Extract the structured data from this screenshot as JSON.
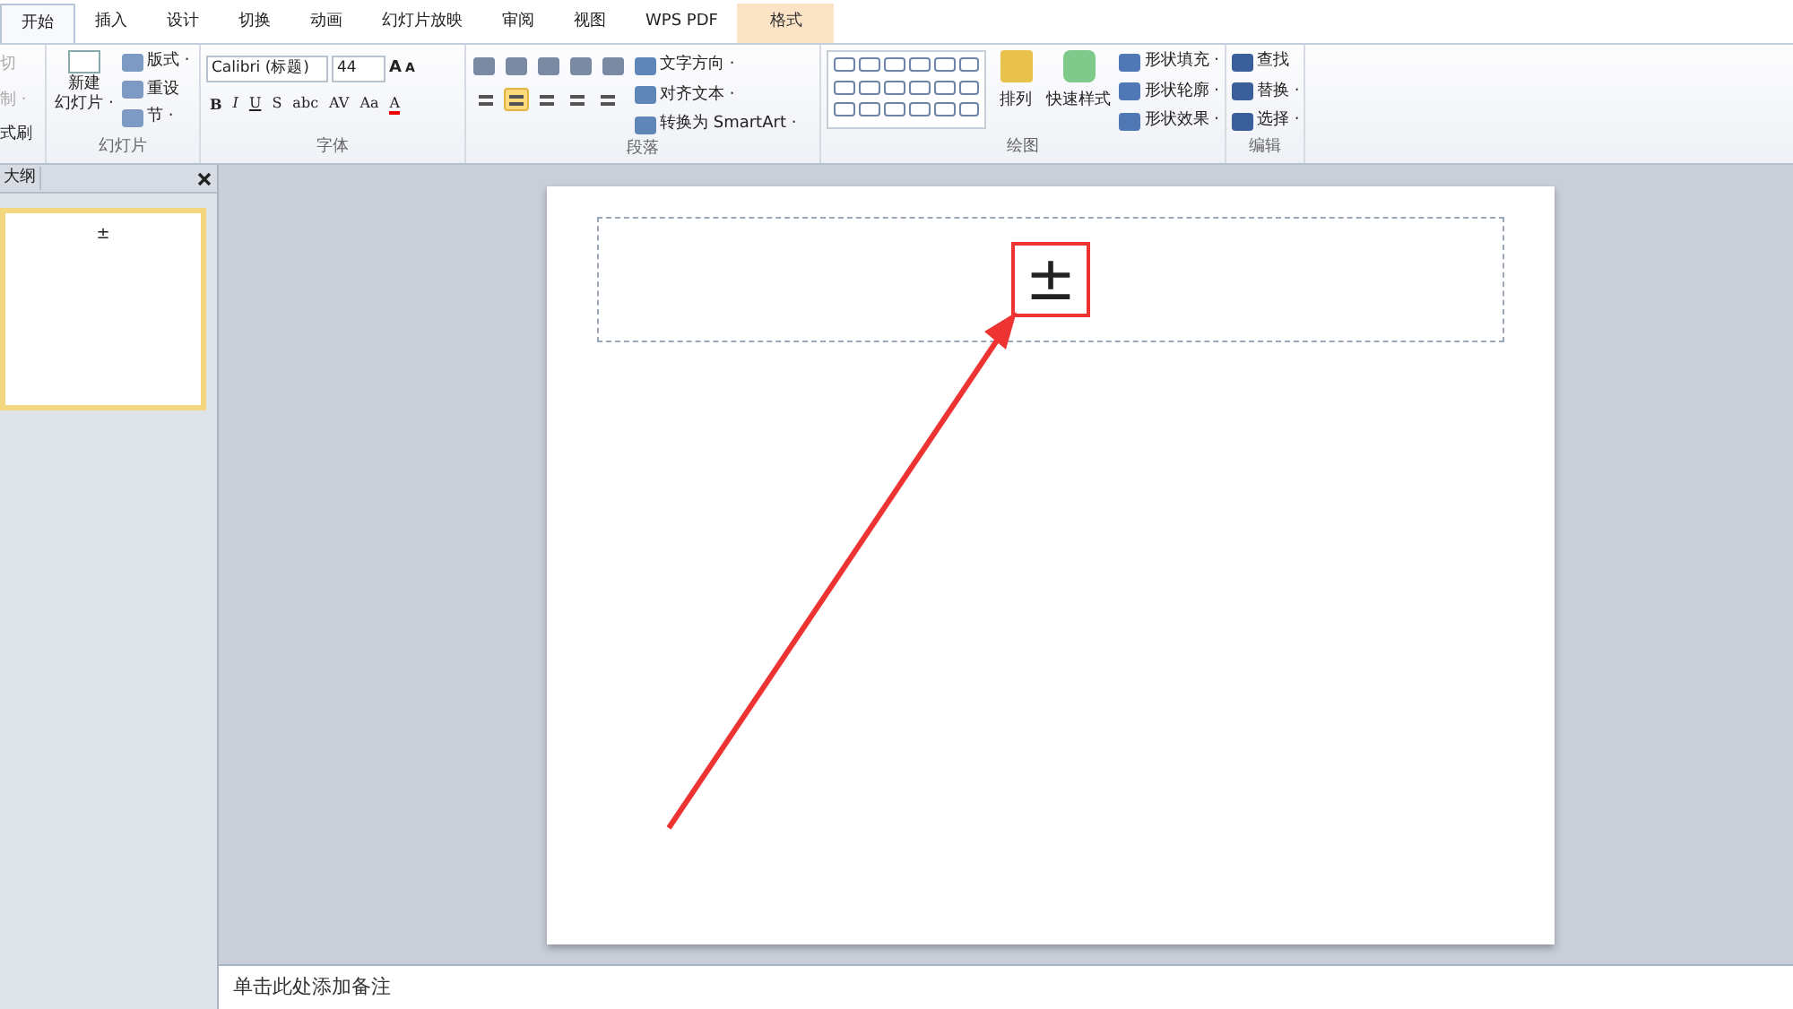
{
  "tabs": [
    {
      "label": "开始",
      "selected": true,
      "kind": "normal"
    },
    {
      "label": "插入",
      "selected": false,
      "kind": "normal"
    },
    {
      "label": "设计",
      "selected": false,
      "kind": "normal"
    },
    {
      "label": "切换",
      "selected": false,
      "kind": "normal"
    },
    {
      "label": "动画",
      "selected": false,
      "kind": "normal"
    },
    {
      "label": "幻灯片放映",
      "selected": false,
      "kind": "normal"
    },
    {
      "label": "审阅",
      "selected": false,
      "kind": "normal"
    },
    {
      "label": "视图",
      "selected": false,
      "kind": "normal"
    },
    {
      "label": "WPS PDF",
      "selected": false,
      "kind": "normal"
    },
    {
      "label": "格式",
      "selected": false,
      "kind": "contextual"
    }
  ],
  "clipboard": {
    "items": [
      {
        "label": "切",
        "disabled": true
      },
      {
        "label": "制 ·",
        "disabled": true
      },
      {
        "label": "式刷",
        "disabled": false
      }
    ]
  },
  "slides_group": {
    "new_slide": "新建",
    "new_slide_2": "幻灯片 ·",
    "items": [
      "版式 ·",
      "重设",
      "节 ·"
    ],
    "label": "幻灯片"
  },
  "font_group": {
    "font_name": "Calibri (标题)",
    "font_size": "44",
    "grow": "A",
    "shrink": "A",
    "buttons": [
      "B",
      "I",
      "U",
      "S",
      "abc",
      "AV",
      "Aa",
      "A"
    ],
    "label": "字体"
  },
  "paragraph_group": {
    "align": [
      {
        "selected": false
      },
      {
        "selected": true
      },
      {
        "selected": false
      },
      {
        "selected": false
      },
      {
        "selected": false
      }
    ],
    "commands": [
      "文字方向 ·",
      "对齐文本 ·",
      "转换为 SmartArt ·"
    ],
    "label": "段落"
  },
  "drawing_group": {
    "arrange": "排列",
    "quick_styles": "快速样式",
    "commands": [
      "形状填充 ·",
      "形状轮廓 ·",
      "形状效果 ·"
    ],
    "label": "绘图"
  },
  "editing_group": {
    "commands": [
      "查找",
      "替换 ·",
      "选择 ·"
    ],
    "label": "编辑"
  },
  "panel": {
    "tab": "大纲",
    "thumbnail_text": "±"
  },
  "slide": {
    "text": "±"
  },
  "notes": {
    "placeholder": "单击此处添加备注"
  }
}
